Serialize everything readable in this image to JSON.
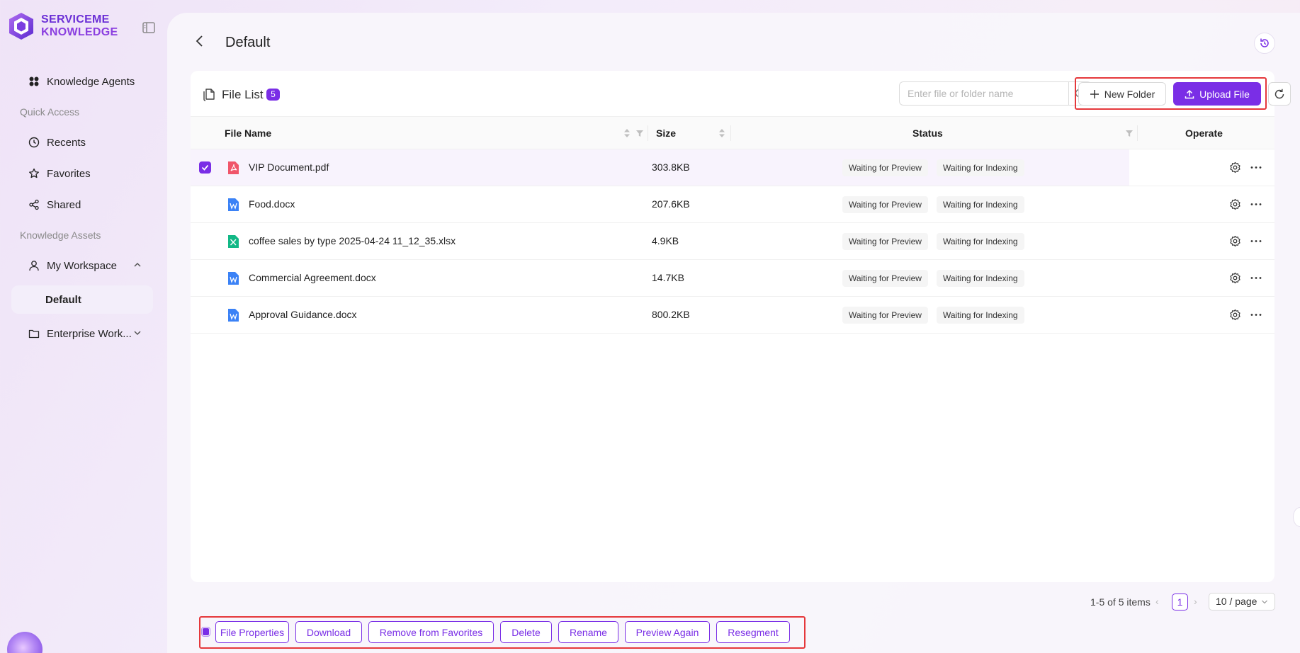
{
  "brand": {
    "line1": "SERVICEME",
    "line2": "KNOWLEDGE",
    "primary": "#7a2ee6"
  },
  "sidebar": {
    "items": [
      {
        "label": "Knowledge Agents",
        "icon": "agents-grid-icon"
      },
      {
        "label": "Recents",
        "icon": "clock-icon"
      },
      {
        "label": "Favorites",
        "icon": "star-icon"
      },
      {
        "label": "Shared",
        "icon": "share-icon"
      },
      {
        "label": "My Workspace",
        "icon": "user-icon"
      },
      {
        "label": "Default"
      },
      {
        "label": "Enterprise Work...",
        "icon": "folder-icon"
      }
    ],
    "sections": {
      "quick_access": "Quick Access",
      "knowledge_assets": "Knowledge Assets"
    }
  },
  "header": {
    "title": "Default"
  },
  "file_list": {
    "title": "File List",
    "count": "5",
    "search_placeholder": "Enter file or folder name",
    "new_folder": "New Folder",
    "upload_file": "Upload File",
    "columns": {
      "name": "File Name",
      "size": "Size",
      "status": "Status",
      "operate": "Operate"
    },
    "rows": [
      {
        "name": "VIP Document.pdf",
        "type": "pdf",
        "size": "303.8KB",
        "status1": "Waiting for Preview",
        "status2": "Waiting for Indexing",
        "selected": true
      },
      {
        "name": "Food.docx",
        "type": "docx",
        "size": "207.6KB",
        "status1": "Waiting for Preview",
        "status2": "Waiting for Indexing",
        "selected": false
      },
      {
        "name": "coffee sales by type 2025-04-24 11_12_35.xlsx",
        "type": "xlsx",
        "size": "4.9KB",
        "status1": "Waiting for Preview",
        "status2": "Waiting for Indexing",
        "selected": false
      },
      {
        "name": "Commercial Agreement.docx",
        "type": "docx",
        "size": "14.7KB",
        "status1": "Waiting for Preview",
        "status2": "Waiting for Indexing",
        "selected": false
      },
      {
        "name": "Approval Guidance.docx",
        "type": "docx",
        "size": "800.2KB",
        "status1": "Waiting for Preview",
        "status2": "Waiting for Indexing",
        "selected": false
      }
    ]
  },
  "pagination": {
    "total": "1-5 of 5 items",
    "current": "1",
    "page_size": "10 / page"
  },
  "actions": {
    "file_properties": "File Properties",
    "download": "Download",
    "remove_favorites": "Remove from Favorites",
    "delete": "Delete",
    "rename": "Rename",
    "preview_again": "Preview Again",
    "resegment": "Resegment"
  }
}
